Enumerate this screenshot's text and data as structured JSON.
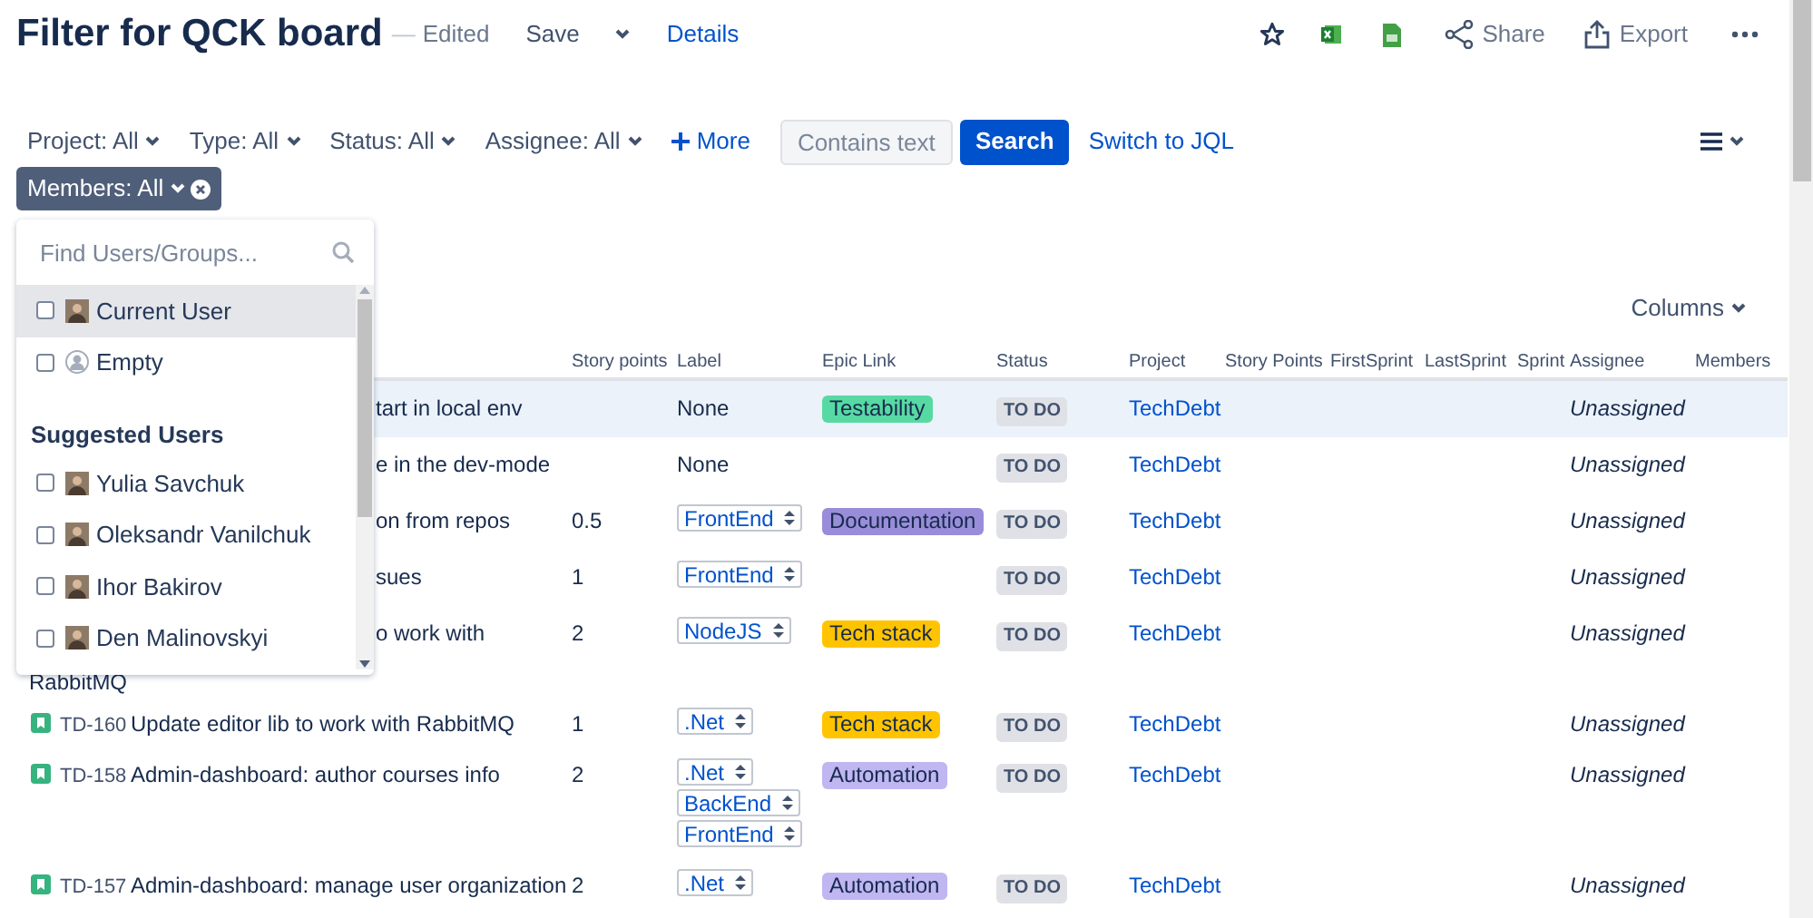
{
  "header": {
    "title": "Filter for QCK board",
    "separator": "—",
    "edited": "Edited",
    "save": "Save",
    "details": "Details",
    "share": "Share",
    "export": "Export"
  },
  "filters": [
    {
      "label": "Project: All"
    },
    {
      "label": "Type: All"
    },
    {
      "label": "Status: All"
    },
    {
      "label": "Assignee: All"
    }
  ],
  "more": "More",
  "text_search": {
    "placeholder": "Contains text"
  },
  "search_button": "Search",
  "switch_jql": "Switch to JQL",
  "members_chip": "Members: All",
  "members_dropdown": {
    "search": {
      "placeholder": "Find Users/Groups..."
    },
    "items": [
      {
        "kind": "user",
        "label": "Current User",
        "checked": false,
        "selected": true
      },
      {
        "kind": "empty",
        "label": "Empty",
        "checked": false,
        "selected": false
      },
      {
        "kind": "heading",
        "label": "Suggested Users"
      },
      {
        "kind": "user",
        "label": "Yulia Savchuk",
        "checked": false,
        "selected": false
      },
      {
        "kind": "user",
        "label": "Oleksandr Vanilchuk",
        "checked": false,
        "selected": false
      },
      {
        "kind": "user",
        "label": "Ihor Bakirov",
        "checked": false,
        "selected": false
      },
      {
        "kind": "user",
        "label": "Den Malinovskyi",
        "checked": false,
        "selected": false
      }
    ]
  },
  "columns_button": "Columns",
  "table": {
    "columns": [
      "Story points",
      "Label",
      "Epic Link",
      "Status",
      "Project",
      "Story Points",
      "FirstSprint",
      "LastSprint",
      "Sprint",
      "Assignee",
      "Members"
    ],
    "rows": [
      {
        "kind": "partial",
        "selected": true,
        "summary": "tart in local env",
        "story_points": "",
        "labels": [
          {
            "kind": "text",
            "text": "None"
          }
        ],
        "epic": {
          "text": "Testability",
          "color": "#57d9a3"
        },
        "status": "TO DO",
        "project": "TechDebt",
        "assignee": "Unassigned"
      },
      {
        "kind": "partial",
        "selected": false,
        "summary": "e in the dev-mode",
        "story_points": "",
        "labels": [
          {
            "kind": "text",
            "text": "None"
          }
        ],
        "status": "TO DO",
        "project": "TechDebt",
        "assignee": "Unassigned"
      },
      {
        "kind": "partial",
        "selected": false,
        "summary": "on from repos",
        "story_points": "0.5",
        "labels": [
          {
            "kind": "select",
            "text": "FrontEnd"
          }
        ],
        "epic": {
          "text": "Documentation",
          "color": "#998dd9"
        },
        "status": "TO DO",
        "project": "TechDebt",
        "assignee": "Unassigned"
      },
      {
        "kind": "partial",
        "selected": false,
        "summary": "sues",
        "story_points": "1",
        "labels": [
          {
            "kind": "select",
            "text": "FrontEnd"
          }
        ],
        "status": "TO DO",
        "project": "TechDebt",
        "assignee": "Unassigned"
      },
      {
        "kind": "partial",
        "selected": false,
        "summary": "o work with",
        "continuation": "RabbitMQ",
        "story_points": "2",
        "labels": [
          {
            "kind": "select",
            "text": "NodeJS"
          }
        ],
        "epic": {
          "text": "Tech stack",
          "color": "#ffc400"
        },
        "status": "TO DO",
        "project": "TechDebt",
        "assignee": "Unassigned"
      },
      {
        "kind": "full",
        "selected": false,
        "key": "TD-160",
        "summary": "Update editor lib to work with RabbitMQ",
        "story_points": "1",
        "labels": [
          {
            "kind": "select",
            "text": ".Net"
          }
        ],
        "epic": {
          "text": "Tech stack",
          "color": "#ffc400"
        },
        "status": "TO DO",
        "project": "TechDebt",
        "assignee": "Unassigned"
      },
      {
        "kind": "full",
        "selected": false,
        "key": "TD-158",
        "summary": "Admin-dashboard: author courses info",
        "story_points": "2",
        "labels": [
          {
            "kind": "select",
            "text": ".Net"
          },
          {
            "kind": "select",
            "text": "BackEnd"
          },
          {
            "kind": "select",
            "text": "FrontEnd"
          }
        ],
        "epic": {
          "text": "Automation",
          "color": "#c0b6f2"
        },
        "status": "TO DO",
        "project": "TechDebt",
        "assignee": "Unassigned"
      },
      {
        "kind": "full",
        "selected": false,
        "key": "TD-157",
        "summary": "Admin-dashboard: manage user organization",
        "story_points": "2",
        "labels": [
          {
            "kind": "select",
            "text": ".Net"
          }
        ],
        "epic": {
          "text": "Automation",
          "color": "#c0b6f2"
        },
        "status": "TO DO",
        "project": "TechDebt",
        "assignee": "Unassigned"
      }
    ]
  }
}
